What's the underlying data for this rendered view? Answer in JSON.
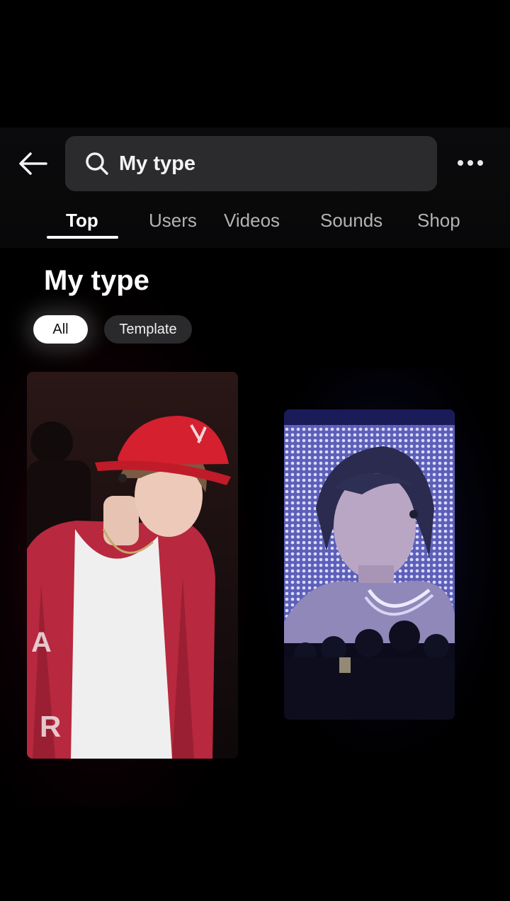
{
  "search": {
    "query": "My type"
  },
  "tabs": [
    {
      "label": "Top"
    },
    {
      "label": "Users"
    },
    {
      "label": "Videos"
    },
    {
      "label": "Sounds"
    },
    {
      "label": "Shop"
    }
  ],
  "results": {
    "title": "My type",
    "chips": [
      {
        "label": "All"
      },
      {
        "label": "Template"
      }
    ]
  },
  "icons": {
    "back": "back-arrow-icon",
    "search": "search-icon",
    "more": "more-dots-icon"
  },
  "colors": {
    "background": "#000000",
    "search_bg": "#2b2b2e",
    "active_chip": "#ffffff",
    "chip_bg": "#2a2a2d",
    "tab_inactive": "#b3b3b6"
  }
}
